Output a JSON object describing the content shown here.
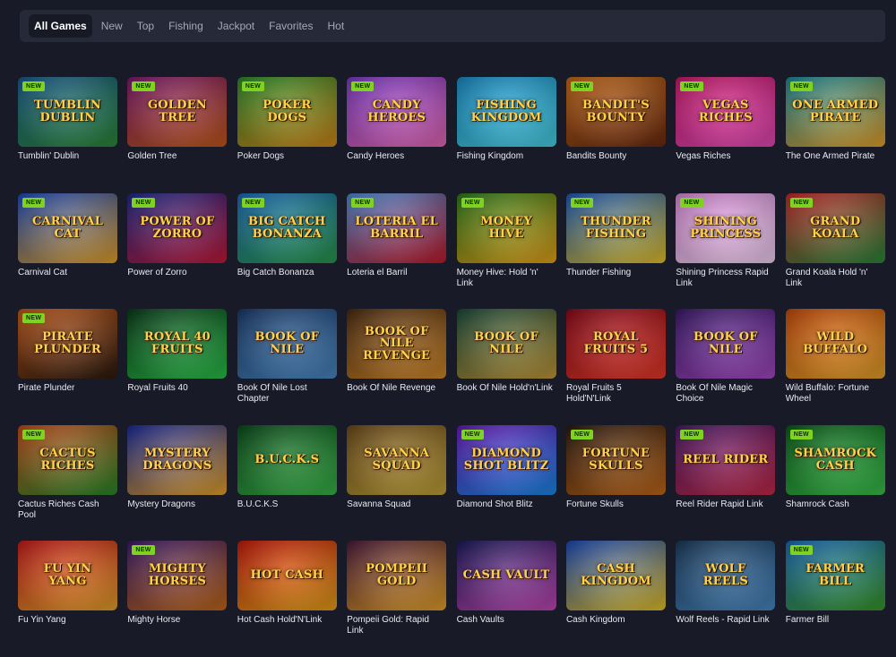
{
  "tabs": [
    "All Games",
    "New",
    "Top",
    "Fishing",
    "Jackpot",
    "Favorites",
    "Hot"
  ],
  "badge_label": "NEW",
  "games": [
    {
      "name": "Tumblin' Dublin",
      "logo": "Tumblin Dublin",
      "new": true,
      "colors": [
        "#1a5a8c",
        "#2e8a3a"
      ]
    },
    {
      "name": "Golden Tree",
      "logo": "Golden Tree",
      "new": true,
      "colors": [
        "#7a1a6e",
        "#c45a1a"
      ]
    },
    {
      "name": "Poker Dogs",
      "logo": "Poker Dogs",
      "new": true,
      "colors": [
        "#2a8a2a",
        "#d48a1a"
      ]
    },
    {
      "name": "Candy Heroes",
      "logo": "Candy Heroes",
      "new": true,
      "colors": [
        "#7a3ac4",
        "#e86ab8"
      ]
    },
    {
      "name": "Fishing Kingdom",
      "logo": "Fishing Kingdom",
      "new": false,
      "colors": [
        "#1a8ac4",
        "#4ad4e8"
      ]
    },
    {
      "name": "Bandits Bounty",
      "logo": "Bandit's Bounty",
      "new": true,
      "colors": [
        "#c46a1a",
        "#6a2a10"
      ]
    },
    {
      "name": "Vegas Riches",
      "logo": "Vegas Riches",
      "new": true,
      "colors": [
        "#c41a6a",
        "#e84ab8"
      ]
    },
    {
      "name": "The One Armed Pirate",
      "logo": "One Armed Pirate",
      "new": true,
      "colors": [
        "#1a8a9a",
        "#e8a42a"
      ]
    },
    {
      "name": "Carnival Cat",
      "logo": "Carnival Cat",
      "new": true,
      "colors": [
        "#1a4ab8",
        "#e8a42a"
      ]
    },
    {
      "name": "Power of Zorro",
      "logo": "Power of Zorro",
      "new": true,
      "colors": [
        "#1a2a8a",
        "#c41a3a"
      ]
    },
    {
      "name": "Big Catch Bonanza",
      "logo": "Big Catch Bonanza",
      "new": true,
      "colors": [
        "#1a6ab8",
        "#2a9a4a"
      ]
    },
    {
      "name": "Loteria el Barril",
      "logo": "Loteria el Barril",
      "new": true,
      "colors": [
        "#4a8ad4",
        "#c41a2a"
      ]
    },
    {
      "name": "Money Hive: Hold 'n' Link",
      "logo": "Money Hive",
      "new": true,
      "colors": [
        "#2a7a1a",
        "#e8a41a"
      ]
    },
    {
      "name": "Thunder Fishing",
      "logo": "Thunder Fishing",
      "new": true,
      "colors": [
        "#1a5ab8",
        "#e8c42a"
      ]
    },
    {
      "name": "Shining Princess Rapid Link",
      "logo": "Shining Princess",
      "new": true,
      "colors": [
        "#d48ad4",
        "#f4d4f4"
      ]
    },
    {
      "name": "Grand Koala Hold 'n' Link",
      "logo": "Grand Koala",
      "new": true,
      "colors": [
        "#c42a2a",
        "#2a8a3a"
      ]
    },
    {
      "name": "Pirate Plunder",
      "logo": "Pirate Plunder",
      "new": true,
      "colors": [
        "#c45a1a",
        "#2a1a10"
      ]
    },
    {
      "name": "Royal Fruits 40",
      "logo": "Royal 40 Fruits",
      "new": false,
      "colors": [
        "#0a3a1a",
        "#2ac44a"
      ]
    },
    {
      "name": "Book Of Nile Lost Chapter",
      "logo": "Book of Nile",
      "new": false,
      "colors": [
        "#1a3a6a",
        "#4a8ac4"
      ]
    },
    {
      "name": "Book Of Nile Revenge",
      "logo": "Book of Nile Revenge",
      "new": false,
      "colors": [
        "#4a2a10",
        "#d48a2a"
      ]
    },
    {
      "name": "Book Of Nile Hold'n'Link",
      "logo": "Book of Nile",
      "new": false,
      "colors": [
        "#1a4a3a",
        "#c49a3a"
      ]
    },
    {
      "name": "Royal Fruits 5 Hold'N'Link",
      "logo": "Royal Fruits 5",
      "new": false,
      "colors": [
        "#8a0a1a",
        "#e83a2a"
      ]
    },
    {
      "name": "Book Of Nile Magic Choice",
      "logo": "Book of Nile",
      "new": false,
      "colors": [
        "#3a1a6a",
        "#a44ac4"
      ]
    },
    {
      "name": "Wild Buffalo: Fortune Wheel",
      "logo": "Wild Buffalo",
      "new": false,
      "colors": [
        "#c44a0a",
        "#e8a42a"
      ]
    },
    {
      "name": "Cactus Riches Cash Pool",
      "logo": "Cactus Riches",
      "new": true,
      "colors": [
        "#c44a1a",
        "#2a8a2a"
      ]
    },
    {
      "name": "Mystery Dragons",
      "logo": "Mystery Dragons",
      "new": false,
      "colors": [
        "#1a2a9a",
        "#e8a42a"
      ]
    },
    {
      "name": "B.U.C.K.S",
      "logo": "B.U.C.K.S",
      "new": false,
      "colors": [
        "#0a4a1a",
        "#3ab84a"
      ]
    },
    {
      "name": "Savanna Squad",
      "logo": "Savanna Squad",
      "new": false,
      "colors": [
        "#6a4a1a",
        "#c4a43a"
      ]
    },
    {
      "name": "Diamond Shot Blitz",
      "logo": "Diamond Shot Blitz",
      "new": true,
      "colors": [
        "#6a1ab8",
        "#1a8ae8"
      ]
    },
    {
      "name": "Fortune Skulls",
      "logo": "Fortune Skulls",
      "new": true,
      "colors": [
        "#2a1a10",
        "#c46a1a"
      ]
    },
    {
      "name": "Reel Rider Rapid Link",
      "logo": "Reel Rider",
      "new": true,
      "colors": [
        "#4a1a6a",
        "#c42a4a"
      ]
    },
    {
      "name": "Shamrock Cash",
      "logo": "Shamrock Cash",
      "new": true,
      "colors": [
        "#0a5a1a",
        "#3ac44a"
      ]
    },
    {
      "name": "Fu Yin Yang",
      "logo": "Fu Yin Yang",
      "new": false,
      "colors": [
        "#c41a1a",
        "#e8a42a"
      ]
    },
    {
      "name": "Mighty Horse",
      "logo": "Mighty Horses",
      "new": true,
      "colors": [
        "#3a1a6a",
        "#c46a1a"
      ]
    },
    {
      "name": "Hot Cash Hold'N'Link",
      "logo": "Hot Cash",
      "new": false,
      "colors": [
        "#c41a0a",
        "#e8a41a"
      ]
    },
    {
      "name": "Pompeii Gold: Rapid Link",
      "logo": "Pompeii Gold",
      "new": false,
      "colors": [
        "#4a1a3a",
        "#e8a42a"
      ]
    },
    {
      "name": "Cash Vaults",
      "logo": "Cash Vault",
      "new": false,
      "colors": [
        "#1a1a5a",
        "#c44ab8"
      ]
    },
    {
      "name": "Cash Kingdom",
      "logo": "Cash Kingdom",
      "new": false,
      "colors": [
        "#1a4ab8",
        "#e8c42a"
      ]
    },
    {
      "name": "Wolf Reels - Rapid Link",
      "logo": "Wolf Reels",
      "new": false,
      "colors": [
        "#1a3a5a",
        "#4a8ac4"
      ]
    },
    {
      "name": "Farmer Bill",
      "logo": "Farmer Bill",
      "new": true,
      "colors": [
        "#1a6ab8",
        "#3a9a2a"
      ]
    }
  ]
}
